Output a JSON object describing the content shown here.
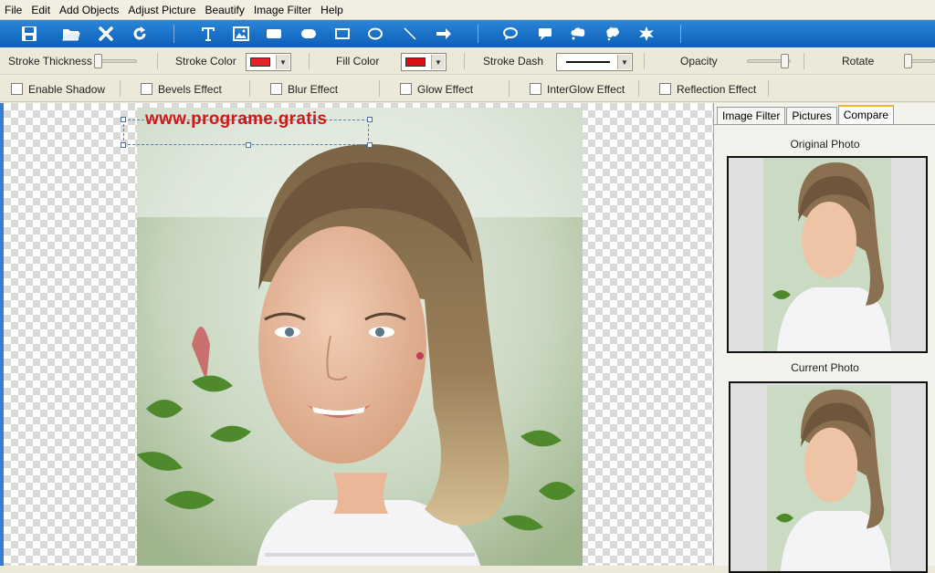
{
  "menu": [
    "File",
    "Edit",
    "Add Objects",
    "Adjust Picture",
    "Beautify",
    "Image Filter",
    "Help"
  ],
  "toolbar": {
    "buttons": [
      "save-icon",
      "open-folder-icon",
      "close-x-icon",
      "refresh-icon",
      "text-icon",
      "image-icon",
      "rectangle-filled-icon",
      "rounded-rectangle-icon",
      "rectangle-outline-icon",
      "ellipse-icon",
      "line-icon",
      "arrow-icon",
      "speech-bubble-round-icon",
      "speech-bubble-rect-icon",
      "speech-bubble-cloud-icon",
      "thought-bubble-icon",
      "star-burst-icon"
    ]
  },
  "props": {
    "stroke_thickness_label": "Stroke Thickness",
    "stroke_color_label": "Stroke Color",
    "stroke_color": "#e8202a",
    "fill_color_label": "Fill Color",
    "fill_color": "#d90f15",
    "stroke_dash_label": "Stroke Dash",
    "opacity_label": "Opacity",
    "opacity_value": 0.85,
    "rotate_label": "Rotate"
  },
  "effects": [
    {
      "label": "Enable Shadow",
      "checked": false
    },
    {
      "label": "Bevels Effect",
      "checked": false
    },
    {
      "label": "Blur Effect",
      "checked": false
    },
    {
      "label": "Glow Effect",
      "checked": false
    },
    {
      "label": "InterGlow Effect",
      "checked": false
    },
    {
      "label": "Reflection Effect",
      "checked": false
    }
  ],
  "canvas": {
    "watermark_text": "www.programe.gratis"
  },
  "panel": {
    "tabs": [
      "Image Filter",
      "Pictures",
      "Compare"
    ],
    "active_tab": "Compare",
    "original_title": "Original Photo",
    "current_title": "Current Photo"
  },
  "colors": {
    "toolbar_blue": "#1a6fc8",
    "watermark_red": "#d41717"
  }
}
